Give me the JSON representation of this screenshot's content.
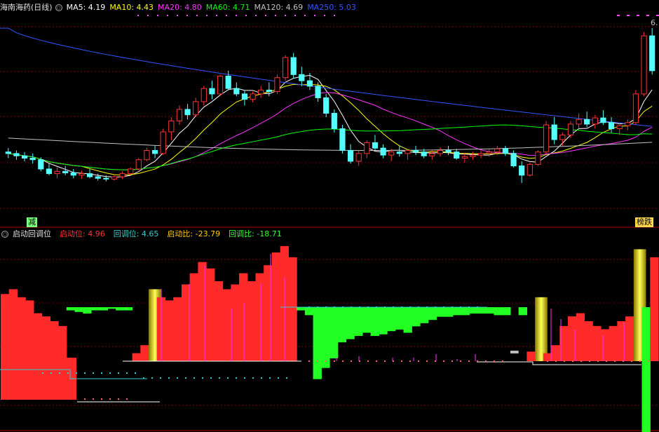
{
  "main_panel": {
    "title": "海南海药(日线)",
    "ma_labels": [
      {
        "text": "MA5: 4.19",
        "color": "#ffffff"
      },
      {
        "text": "MA10: 4.43",
        "color": "#ffff00"
      },
      {
        "text": "MA20: 4.80",
        "color": "#ff33ff"
      },
      {
        "text": "MA60: 4.71",
        "color": "#00ff00"
      },
      {
        "text": "MA120: 4.69",
        "color": "#c0c0c0"
      },
      {
        "text": "MA250: 5.03",
        "color": "#3355ff"
      }
    ],
    "badge_left": "减",
    "badge_right": "榜跌",
    "peak_label": "6."
  },
  "sub_panel": {
    "title": "启动回调位",
    "labels": [
      {
        "text": "启动位: 4.96",
        "color": "#ff3333"
      },
      {
        "text": "回调位: 4.65",
        "color": "#33cccc"
      },
      {
        "text": "启动比: -23.79",
        "color": "#ffcc00"
      },
      {
        "text": "回调比: -18.71",
        "color": "#33ff33"
      }
    ]
  },
  "colors": {
    "up": "#ff3333",
    "down": "#54ffff",
    "grid": "#7a0000",
    "ma5": "#ffffff",
    "ma10": "#ffff00",
    "ma20": "#ff33ff",
    "ma60": "#00ff00",
    "ma120": "#c0c0c0",
    "ma250": "#3355ff"
  },
  "chart_data": {
    "type": "candlestick",
    "y_range": [
      3.9,
      6.5
    ],
    "candles": [
      [
        4.7,
        4.75,
        4.62,
        4.68
      ],
      [
        4.68,
        4.72,
        4.6,
        4.65
      ],
      [
        4.65,
        4.7,
        4.58,
        4.62
      ],
      [
        4.62,
        4.68,
        4.55,
        4.6
      ],
      [
        4.6,
        4.63,
        4.45,
        4.48
      ],
      [
        4.48,
        4.55,
        4.4,
        4.42
      ],
      [
        4.42,
        4.5,
        4.36,
        4.45
      ],
      [
        4.45,
        4.52,
        4.4,
        4.43
      ],
      [
        4.43,
        4.48,
        4.36,
        4.4
      ],
      [
        4.4,
        4.46,
        4.35,
        4.42
      ],
      [
        4.42,
        4.48,
        4.36,
        4.38
      ],
      [
        4.38,
        4.42,
        4.33,
        4.36
      ],
      [
        4.36,
        4.4,
        4.32,
        4.35
      ],
      [
        4.35,
        4.4,
        4.33,
        4.38
      ],
      [
        4.38,
        4.45,
        4.35,
        4.42
      ],
      [
        4.42,
        4.5,
        4.4,
        4.48
      ],
      [
        4.48,
        4.62,
        4.46,
        4.6
      ],
      [
        4.6,
        4.75,
        4.58,
        4.72
      ],
      [
        4.72,
        4.78,
        4.62,
        4.68
      ],
      [
        4.68,
        5.0,
        4.66,
        4.96
      ],
      [
        4.96,
        5.15,
        4.85,
        5.1
      ],
      [
        5.1,
        5.3,
        5.05,
        5.25
      ],
      [
        5.25,
        5.32,
        5.12,
        5.18
      ],
      [
        5.18,
        5.4,
        5.15,
        5.35
      ],
      [
        5.35,
        5.55,
        5.3,
        5.52
      ],
      [
        5.52,
        5.62,
        5.38,
        5.45
      ],
      [
        5.45,
        5.7,
        5.42,
        5.68
      ],
      [
        5.68,
        5.75,
        5.5,
        5.52
      ],
      [
        5.52,
        5.6,
        5.42,
        5.45
      ],
      [
        5.45,
        5.5,
        5.3,
        5.38
      ],
      [
        5.38,
        5.48,
        5.34,
        5.45
      ],
      [
        5.45,
        5.55,
        5.4,
        5.5
      ],
      [
        5.5,
        5.6,
        5.42,
        5.48
      ],
      [
        5.48,
        5.7,
        5.45,
        5.66
      ],
      [
        5.66,
        5.95,
        5.62,
        5.92
      ],
      [
        5.92,
        5.98,
        5.65,
        5.7
      ],
      [
        5.7,
        5.8,
        5.55,
        5.62
      ],
      [
        5.62,
        5.72,
        5.5,
        5.55
      ],
      [
        5.55,
        5.6,
        5.35,
        5.4
      ],
      [
        5.4,
        5.45,
        5.15,
        5.2
      ],
      [
        5.2,
        5.25,
        4.95,
        5.0
      ],
      [
        5.0,
        5.05,
        4.68,
        4.72
      ],
      [
        4.72,
        4.8,
        4.55,
        4.58
      ],
      [
        4.58,
        4.72,
        4.52,
        4.68
      ],
      [
        4.68,
        4.85,
        4.62,
        4.82
      ],
      [
        4.82,
        4.92,
        4.72,
        4.75
      ],
      [
        4.75,
        4.8,
        4.62,
        4.66
      ],
      [
        4.66,
        4.74,
        4.58,
        4.7
      ],
      [
        4.7,
        4.78,
        4.64,
        4.68
      ],
      [
        4.68,
        4.74,
        4.6,
        4.72
      ],
      [
        4.72,
        4.78,
        4.66,
        4.7
      ],
      [
        4.7,
        4.74,
        4.62,
        4.65
      ],
      [
        4.65,
        4.72,
        4.6,
        4.68
      ],
      [
        4.68,
        4.76,
        4.64,
        4.72
      ],
      [
        4.72,
        4.78,
        4.66,
        4.7
      ],
      [
        4.7,
        4.74,
        4.6,
        4.62
      ],
      [
        4.62,
        4.68,
        4.56,
        4.64
      ],
      [
        4.64,
        4.7,
        4.6,
        4.66
      ],
      [
        4.66,
        4.72,
        4.62,
        4.68
      ],
      [
        4.68,
        4.74,
        4.64,
        4.7
      ],
      [
        4.7,
        4.78,
        4.66,
        4.74
      ],
      [
        4.74,
        4.78,
        4.65,
        4.68
      ],
      [
        4.68,
        4.72,
        4.5,
        4.52
      ],
      [
        4.52,
        4.58,
        4.3,
        4.4
      ],
      [
        4.4,
        4.56,
        4.38,
        4.54
      ],
      [
        4.54,
        4.72,
        4.52,
        4.7
      ],
      [
        4.7,
        5.1,
        4.68,
        5.05
      ],
      [
        5.05,
        5.15,
        4.8,
        4.86
      ],
      [
        4.86,
        4.95,
        4.78,
        4.92
      ],
      [
        4.92,
        5.1,
        4.88,
        5.06
      ],
      [
        5.06,
        5.2,
        5.0,
        5.12
      ],
      [
        5.12,
        5.22,
        5.02,
        5.06
      ],
      [
        5.06,
        5.18,
        5.0,
        5.14
      ],
      [
        5.14,
        5.24,
        5.05,
        5.08
      ],
      [
        5.08,
        5.15,
        4.95,
        5.0
      ],
      [
        5.0,
        5.08,
        4.92,
        5.04
      ],
      [
        5.04,
        5.12,
        4.98,
        5.08
      ],
      [
        5.08,
        5.5,
        5.05,
        5.45
      ],
      [
        5.45,
        6.25,
        5.42,
        6.2
      ],
      [
        6.2,
        6.3,
        5.7,
        5.75
      ]
    ],
    "sub_bars": [
      {
        "type": "red",
        "value": 0.42
      },
      {
        "type": "red",
        "value": 0.45
      },
      {
        "type": "red",
        "value": 0.4
      },
      {
        "type": "red",
        "value": 0.38
      },
      {
        "type": "red",
        "value": 0.3
      },
      {
        "type": "red",
        "value": 0.28
      },
      {
        "type": "red",
        "value": 0.25
      },
      {
        "type": "red",
        "value": 0.22
      },
      {
        "type": "green",
        "value": 0.02
      },
      {
        "type": "green",
        "value": 0.03
      },
      {
        "type": "green",
        "value": 0.04
      },
      {
        "type": "green",
        "value": 0.02
      },
      {
        "type": "green",
        "value": 0.02
      },
      {
        "type": "green",
        "value": 0.01
      },
      {
        "type": "green",
        "value": 0.02
      },
      {
        "type": "green",
        "value": 0.02
      },
      {
        "type": "red",
        "value": 0.05
      },
      {
        "type": "red",
        "value": 0.1
      },
      {
        "type": "yellow",
        "value": 0.45
      },
      {
        "type": "red",
        "value": 0.4
      },
      {
        "type": "red",
        "value": 0.38
      },
      {
        "type": "red",
        "value": 0.4
      },
      {
        "type": "red",
        "value": 0.48
      },
      {
        "type": "red",
        "value": 0.55
      },
      {
        "type": "red",
        "value": 0.62
      },
      {
        "type": "red",
        "value": 0.58
      },
      {
        "type": "red",
        "value": 0.5
      },
      {
        "type": "red",
        "value": 0.45
      },
      {
        "type": "red",
        "value": 0.48
      },
      {
        "type": "red",
        "value": 0.55
      },
      {
        "type": "red",
        "value": 0.5
      },
      {
        "type": "red",
        "value": 0.55
      },
      {
        "type": "red",
        "value": 0.6
      },
      {
        "type": "red",
        "value": 0.68
      },
      {
        "type": "red",
        "value": 0.72
      },
      {
        "type": "red",
        "value": 0.65
      },
      {
        "type": "green",
        "value": 0.02
      },
      {
        "type": "green",
        "value": 0.05
      },
      {
        "type": "green",
        "value": 0.45
      },
      {
        "type": "green",
        "value": 0.38
      },
      {
        "type": "green",
        "value": 0.32
      },
      {
        "type": "green",
        "value": 0.22
      },
      {
        "type": "green",
        "value": 0.2
      },
      {
        "type": "green",
        "value": 0.18
      },
      {
        "type": "green",
        "value": 0.16
      },
      {
        "type": "green",
        "value": 0.18
      },
      {
        "type": "green",
        "value": 0.17
      },
      {
        "type": "green",
        "value": 0.15
      },
      {
        "type": "green",
        "value": 0.14
      },
      {
        "type": "green",
        "value": 0.16
      },
      {
        "type": "green",
        "value": 0.12
      },
      {
        "type": "green",
        "value": 0.1
      },
      {
        "type": "green",
        "value": 0.08
      },
      {
        "type": "green",
        "value": 0.06
      },
      {
        "type": "green",
        "value": 0.06
      },
      {
        "type": "green",
        "value": 0.05
      },
      {
        "type": "green",
        "value": 0.05
      },
      {
        "type": "green",
        "value": 0.04
      },
      {
        "type": "green",
        "value": 0.04
      },
      {
        "type": "green",
        "value": 0.04
      },
      {
        "type": "green",
        "value": 0.05
      },
      {
        "type": "green",
        "value": 0.05
      },
      {
        "type": "gray",
        "value": 0.01
      },
      {
        "type": "green",
        "value": 0.05
      },
      {
        "type": "red",
        "value": 0.06
      },
      {
        "type": "yellow",
        "value": 0.4
      },
      {
        "type": "red",
        "value": 0.05
      },
      {
        "type": "red",
        "value": 0.1
      },
      {
        "type": "red",
        "value": 0.22
      },
      {
        "type": "red",
        "value": 0.28
      },
      {
        "type": "red",
        "value": 0.3
      },
      {
        "type": "red",
        "value": 0.25
      },
      {
        "type": "red",
        "value": 0.22
      },
      {
        "type": "red",
        "value": 0.2
      },
      {
        "type": "red",
        "value": 0.22
      },
      {
        "type": "red",
        "value": 0.25
      },
      {
        "type": "red",
        "value": 0.28
      },
      {
        "type": "yellow",
        "value": 0.7
      },
      {
        "type": "green",
        "value": 0.8
      },
      {
        "type": "red",
        "value": 0.65
      }
    ]
  }
}
